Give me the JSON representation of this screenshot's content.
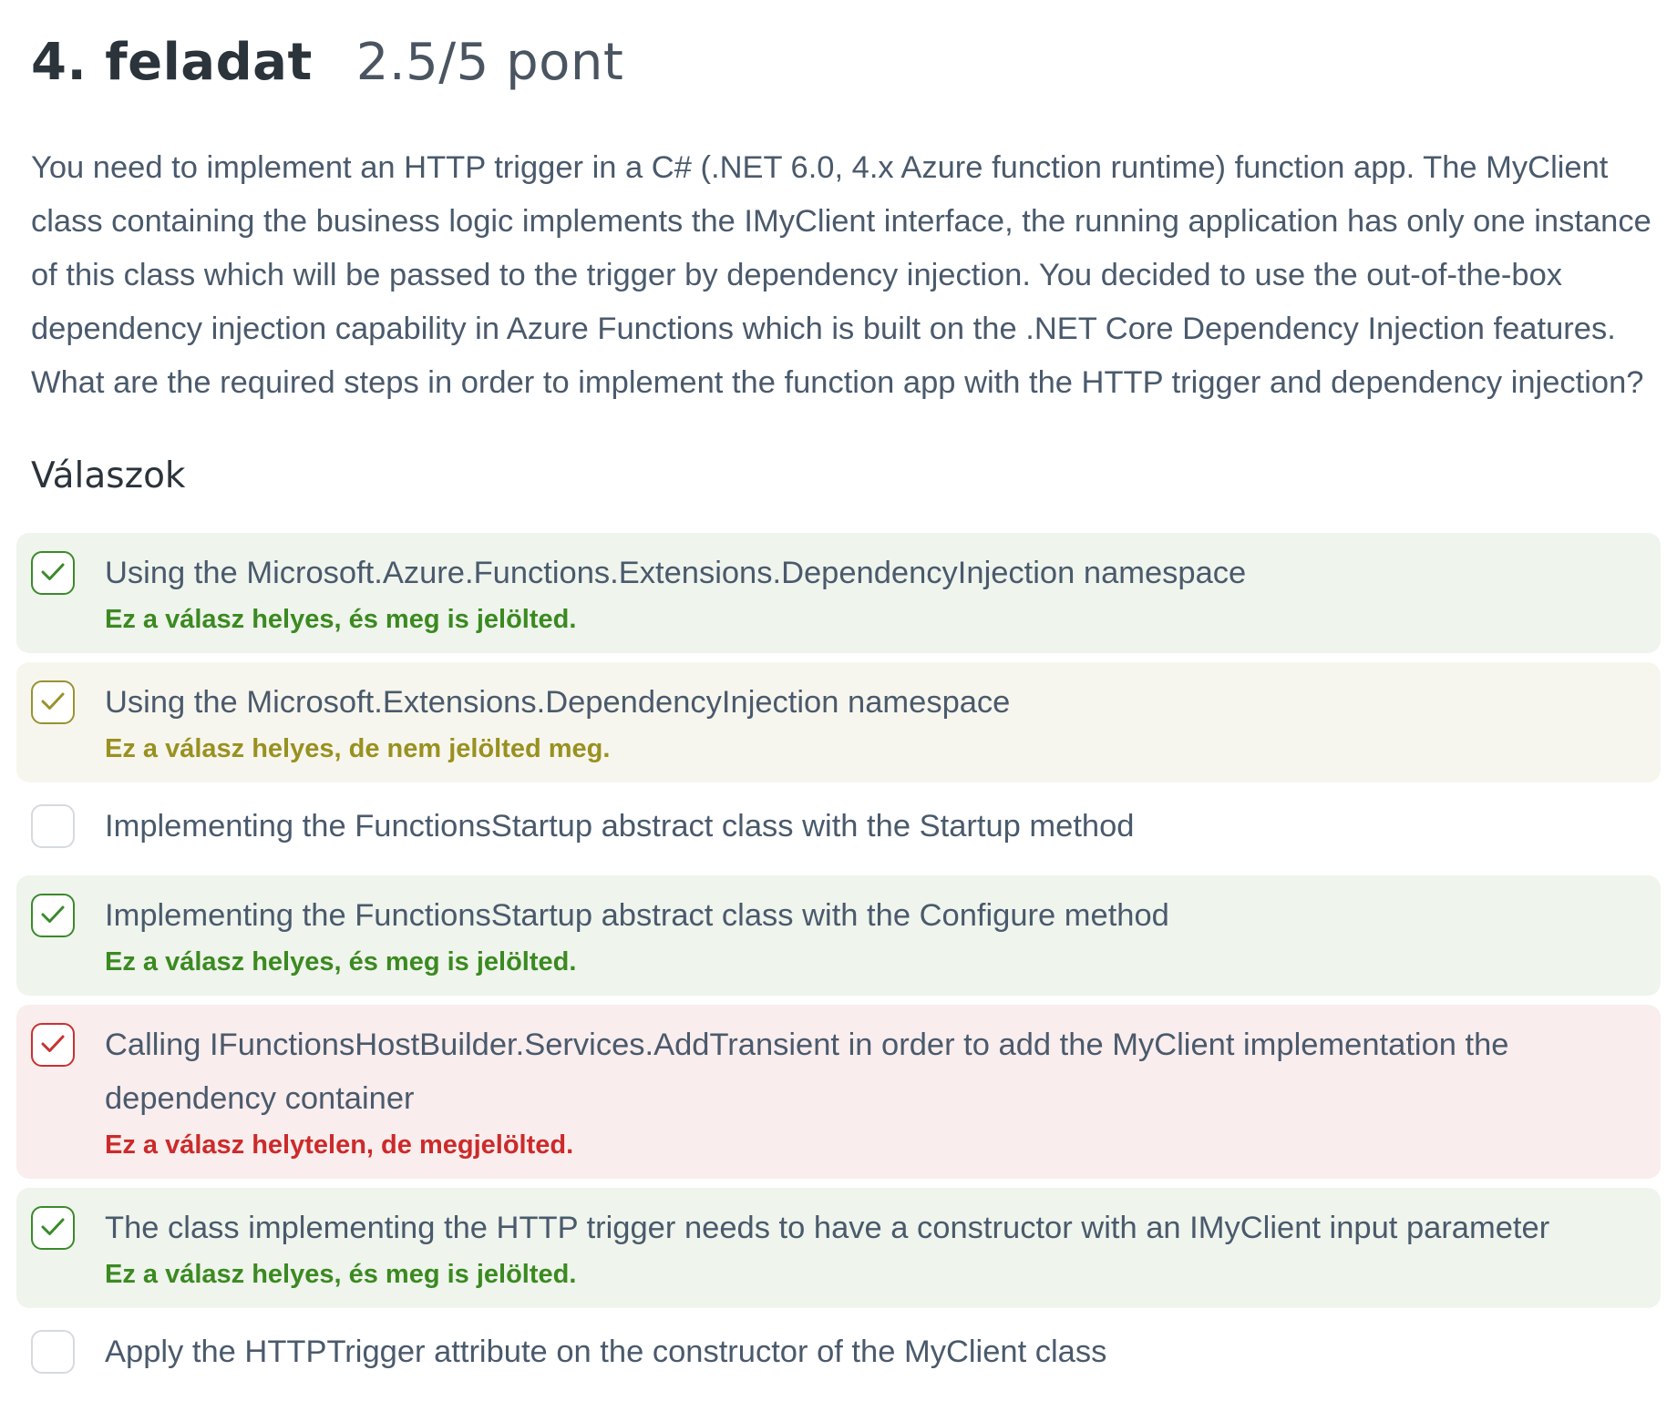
{
  "header": {
    "task_title": "4. feladat",
    "score": "2.5/5 pont"
  },
  "question": "You need to implement an HTTP trigger in a C# (.NET 6.0, 4.x Azure function runtime) function app. The MyClient class containing the business logic implements the IMyClient interface, the running application has only one instance of this class which will be passed to the trigger by dependency injection. You decided to use the out-of-the-box dependency injection capability in Azure Functions which is built on the .NET Core Dependency Injection features. What are the required steps in order to implement the function app with the HTTP trigger and dependency injection?",
  "answers_heading": "Válaszok",
  "colors": {
    "correct_marked_bg": "#eff4ed",
    "correct_missed_bg": "#f7f6ee",
    "wrong_marked_bg": "#f9eded",
    "green": "#3b8a20",
    "olive": "#999120",
    "red": "#cc2a2a"
  },
  "answers": [
    {
      "text": "Using the Microsoft.Azure.Functions.Extensions.DependencyInjection namespace",
      "checkbox_icon": "check-icon",
      "feedback": "Ez a válasz helyes, és meg is jelölted."
    },
    {
      "text": "Using the Microsoft.Extensions.DependencyInjection namespace",
      "checkbox_icon": "check-icon",
      "feedback": "Ez a válasz helyes, de nem jelölted meg."
    },
    {
      "text": "Implementing the FunctionsStartup abstract class with the Startup method",
      "checkbox_icon": null,
      "feedback": null
    },
    {
      "text": "Implementing the FunctionsStartup abstract class with the Configure method",
      "checkbox_icon": "check-icon",
      "feedback": "Ez a válasz helyes, és meg is jelölted."
    },
    {
      "text": "Calling IFunctionsHostBuilder.Services.AddTransient in order to add the MyClient implementation the dependency container",
      "checkbox_icon": "check-icon",
      "feedback": "Ez a válasz helytelen, de megjelölted."
    },
    {
      "text": "The class implementing the HTTP trigger needs to have a constructor with an IMyClient input parameter",
      "checkbox_icon": "check-icon",
      "feedback": "Ez a válasz helyes, és meg is jelölted."
    },
    {
      "text": "Apply the HTTPTrigger attribute on the constructor of the MyClient class",
      "checkbox_icon": null,
      "feedback": null
    }
  ]
}
